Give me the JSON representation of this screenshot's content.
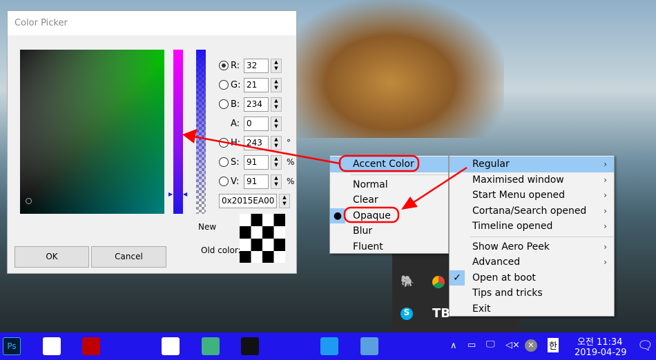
{
  "picker": {
    "title": "Color Picker",
    "fields": [
      {
        "label": "R:",
        "value": "32",
        "radio": true,
        "checked": true
      },
      {
        "label": "G:",
        "value": "21",
        "radio": true
      },
      {
        "label": "B:",
        "value": "234",
        "radio": true
      },
      {
        "label": "A:",
        "value": "0",
        "radio": false
      },
      {
        "label": "H:",
        "value": "243",
        "radio": true,
        "unit": "°"
      },
      {
        "label": "S:",
        "value": "91",
        "radio": true,
        "unit": "%"
      },
      {
        "label": "V:",
        "value": "91",
        "radio": true,
        "unit": "%"
      }
    ],
    "hex": "0x2015EA00",
    "new_label": "New",
    "old_label": "Old color:",
    "ok": "OK",
    "cancel": "Cancel",
    "current_color": "#2015EA"
  },
  "menu1": {
    "items": [
      "Accent Color",
      "Normal",
      "Clear",
      "Opaque",
      "Blur",
      "Fluent"
    ],
    "selected": "Opaque"
  },
  "menu2": {
    "items": [
      "Regular",
      "Maximised window",
      "Start Menu opened",
      "Cortana/Search opened",
      "Timeline opened",
      "Show Aero Peek",
      "Advanced",
      "Open at boot",
      "Tips and tricks",
      "Exit"
    ],
    "checked": "Open at boot"
  },
  "taskbar": {
    "color": "#2015EA",
    "apps": [
      "photoshop",
      "hangul-app",
      "filezilla",
      "network",
      "evernote",
      "atom",
      "terminal",
      "virtualbox",
      "ebook",
      "calculator",
      "translucenttb"
    ],
    "ime": "한",
    "time": "오전 11:34",
    "date": "2019-04-29"
  },
  "annotation_color": "#FF0000"
}
